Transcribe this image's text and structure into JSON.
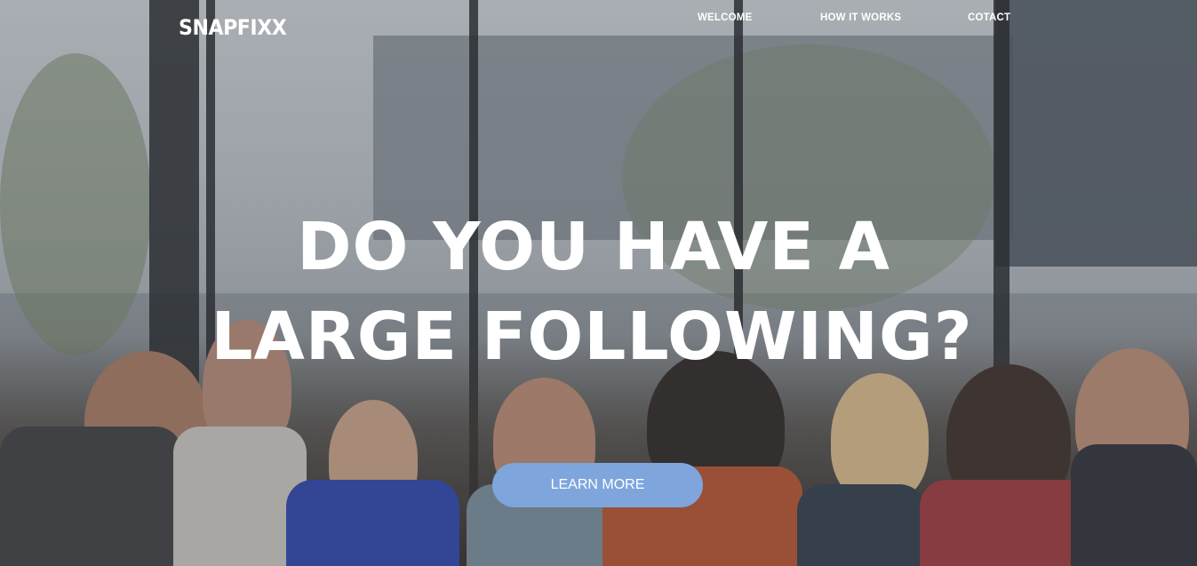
{
  "header": {
    "logo": "SNAPFIXX",
    "nav": [
      {
        "label": "WELCOME"
      },
      {
        "label": "HOW IT WORKS"
      },
      {
        "label": "COTACT"
      }
    ]
  },
  "hero": {
    "headline_line1": "DO YOU HAVE A",
    "headline_line2": "LARGE FOLLOWING?",
    "cta_label": "LEARN MORE"
  },
  "colors": {
    "accent": "#7ea6dc",
    "text": "#ffffff"
  }
}
